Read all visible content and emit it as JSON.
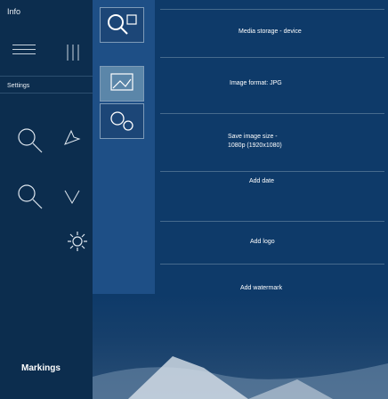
{
  "sidebar": {
    "info_label": "Info",
    "settings_label": "Settings",
    "bottom_label": "Markings"
  },
  "options": {
    "storage_label": "Media storage - device",
    "format_label": "Image format: JPG",
    "size_line1": "Save image size -",
    "size_line2": "1080p (1920x1080)",
    "date_label": "Add date",
    "logo_label": "Add logo",
    "watermark_label": "Add watermark"
  },
  "colors": {
    "sidebar_bg": "#0c2d4e",
    "middle_bg": "#1e4f86",
    "options_bg": "#0e3a69",
    "selected_cell": "#5b86a9"
  },
  "icons": [
    "menu-icon",
    "vertical-bars-icon",
    "search-icon",
    "zoom-out-icon",
    "signal-icon",
    "settings-gear-icon",
    "cursor-icon",
    "gallery-icon",
    "gears-icon"
  ]
}
